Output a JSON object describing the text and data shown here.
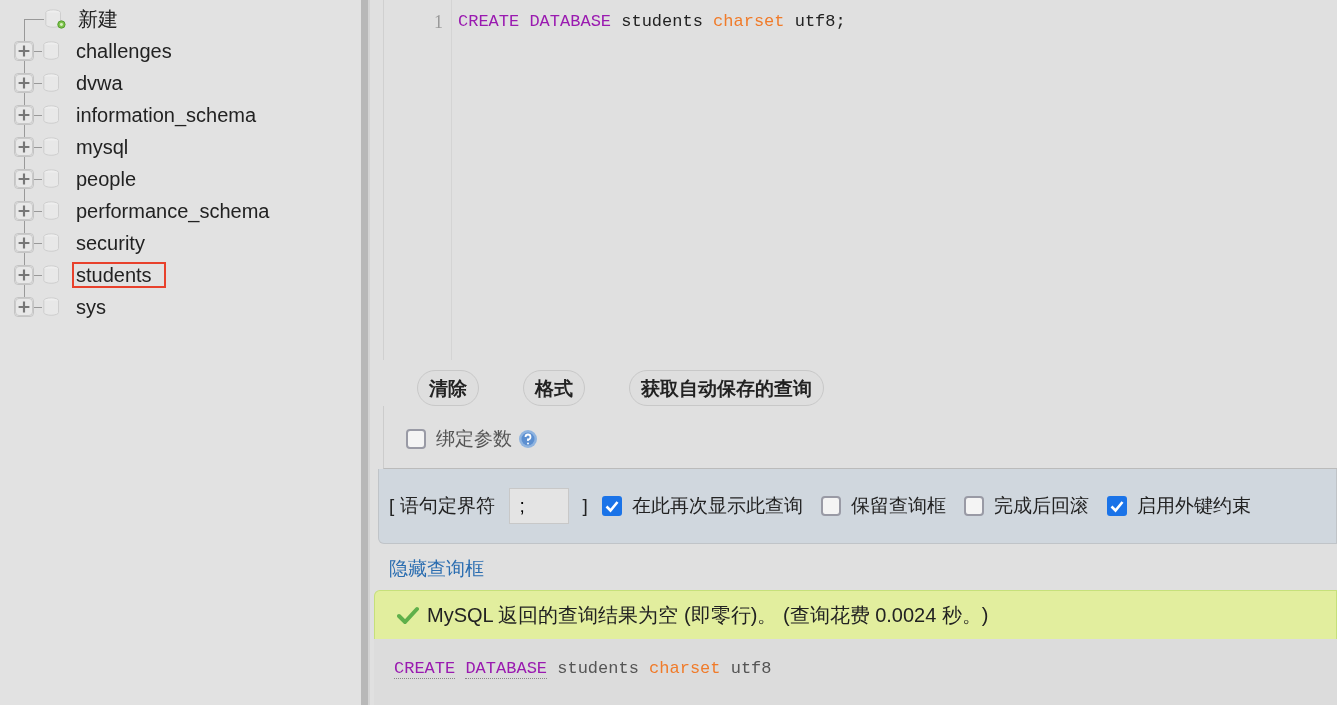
{
  "sidebar": {
    "items": [
      {
        "label": "新建",
        "kind": "new",
        "highlighted": false
      },
      {
        "label": "challenges",
        "kind": "database",
        "highlighted": false
      },
      {
        "label": "dvwa",
        "kind": "database",
        "highlighted": false
      },
      {
        "label": "information_schema",
        "kind": "database",
        "highlighted": false
      },
      {
        "label": "mysql",
        "kind": "database",
        "highlighted": false
      },
      {
        "label": "people",
        "kind": "database",
        "highlighted": false
      },
      {
        "label": "performance_schema",
        "kind": "database",
        "highlighted": false
      },
      {
        "label": "security",
        "kind": "database",
        "highlighted": false
      },
      {
        "label": "students",
        "kind": "database",
        "highlighted": true
      },
      {
        "label": "sys",
        "kind": "database",
        "highlighted": false
      }
    ]
  },
  "editor": {
    "line_number": "1",
    "tokens": [
      {
        "text": "CREATE",
        "kind": "keyword"
      },
      {
        "text": "DATABASE",
        "kind": "keyword"
      },
      {
        "text": "students",
        "kind": "plain"
      },
      {
        "text": "charset",
        "kind": "option"
      },
      {
        "text": "utf8;",
        "kind": "plain"
      }
    ]
  },
  "buttons": [
    "清除",
    "格式",
    "获取自动保存的查询"
  ],
  "bind_parameters": {
    "label": "绑定参数",
    "checked": false
  },
  "options": {
    "delimiter_open": "[ 语句定界符",
    "delimiter_value": ";",
    "delimiter_close": "]",
    "checkboxes": [
      {
        "label": "在此再次显示此查询",
        "checked": true
      },
      {
        "label": "保留查询框",
        "checked": false
      },
      {
        "label": "完成后回滚",
        "checked": false
      },
      {
        "label": "启用外键约束",
        "checked": true
      }
    ]
  },
  "hide_link": "隐藏查询框",
  "result": {
    "message": "MySQL 返回的查询结果为空 (即零行)。 (查询花费 0.0024 秒。)",
    "tokens": [
      {
        "text": "CREATE",
        "kind": "keyword"
      },
      {
        "text": "DATABASE",
        "kind": "keyword"
      },
      {
        "text": "students",
        "kind": "plain"
      },
      {
        "text": "charset",
        "kind": "option"
      },
      {
        "text": "utf8",
        "kind": "plain"
      }
    ]
  }
}
